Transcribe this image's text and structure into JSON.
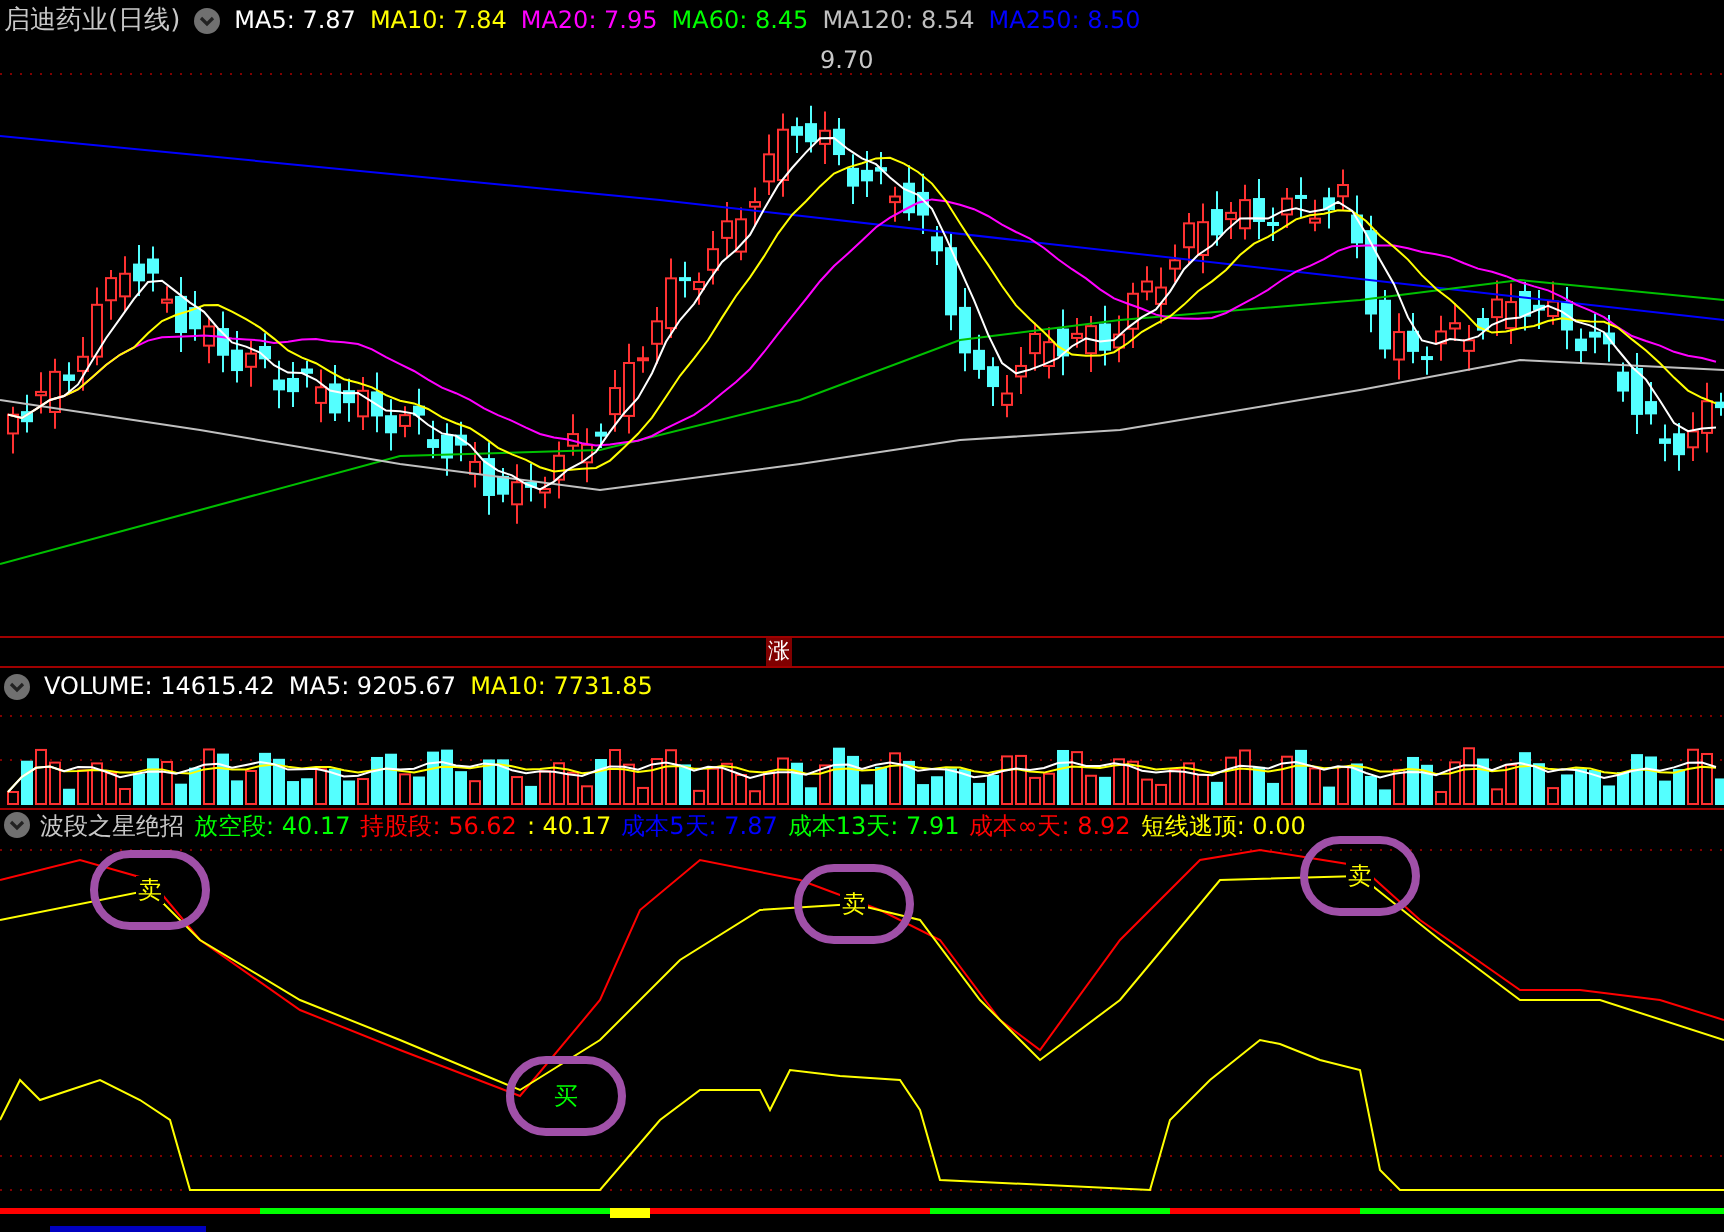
{
  "header": {
    "title": "启迪药业(日线)",
    "indicators": [
      {
        "label": "MA5: 7.87",
        "color": "#ffffff"
      },
      {
        "label": "MA10: 7.84",
        "color": "#ffff00"
      },
      {
        "label": "MA20: 7.95",
        "color": "#ff00ff"
      },
      {
        "label": "MA60: 8.45",
        "color": "#00ff00"
      },
      {
        "label": "MA120: 8.54",
        "color": "#c0c0c0"
      },
      {
        "label": "MA250: 8.50",
        "color": "#0000ff"
      }
    ]
  },
  "price_chart": {
    "peak_label": "9.70"
  },
  "rise_badge": "涨",
  "volume": {
    "indicators": [
      {
        "label": "VOLUME: 14615.42",
        "color": "#ffffff"
      },
      {
        "label": "MA5: 9205.67",
        "color": "#ffffff"
      },
      {
        "label": "MA10: 7731.85",
        "color": "#ffff00"
      }
    ]
  },
  "oscillator": {
    "title": "波段之星绝招",
    "indicators": [
      {
        "label": "放空段: 40.17",
        "color": "#00ff00"
      },
      {
        "label": "持股段: 56.62",
        "color": "#ff0000"
      },
      {
        "label": ": 40.17",
        "color": "#ffff00"
      },
      {
        "label": "成本5天: 7.87",
        "color": "#0000ff"
      },
      {
        "label": "成本13天: 7.91",
        "color": "#00ff00"
      },
      {
        "label": "成本∞天: 8.92",
        "color": "#ff0000"
      },
      {
        "label": "短线逃顶: 0.00",
        "color": "#ffff00"
      }
    ],
    "signals": [
      {
        "text": "卖",
        "kind": "sell"
      },
      {
        "text": "卖",
        "kind": "sell"
      },
      {
        "text": "卖",
        "kind": "sell"
      },
      {
        "text": "买",
        "kind": "buy"
      }
    ]
  }
}
